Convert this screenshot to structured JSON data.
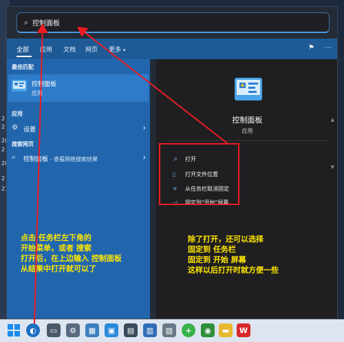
{
  "search": {
    "icon": "search-icon",
    "value": "控制面板"
  },
  "tabs": [
    {
      "label": "全部",
      "active": true
    },
    {
      "label": "应用"
    },
    {
      "label": "文档"
    },
    {
      "label": "网页"
    },
    {
      "label": "更多"
    }
  ],
  "tab_caret": "▾",
  "left": {
    "best_match_label": "最佳匹配",
    "best_match": {
      "title": "控制面板",
      "subtitle": "应用"
    },
    "apps_label": "应用",
    "settings_item": "设置",
    "web_label": "搜索网页",
    "web_item": {
      "title": "控制面板",
      "suffix": " - 查看网络搜索结果"
    }
  },
  "right": {
    "title": "控制面板",
    "subtitle": "应用",
    "actions": [
      {
        "icon": "open-icon",
        "label": "打开"
      },
      {
        "icon": "folder-location-icon",
        "label": "打开文件位置"
      },
      {
        "icon": "unpin-icon",
        "label": "从任务栏取消固定"
      },
      {
        "icon": "pin-icon",
        "label": "固定到\"开始\"屏幕"
      }
    ]
  },
  "annotations": {
    "left_lines": [
      "点击 任务栏左下角的",
      "开始菜单，或者 搜索",
      "打开后，在上边输入 控制面板",
      "从结果中打开就可以了"
    ],
    "right_lines": [
      "除了打开，还可以选择",
      "固定到 任务栏",
      "固定到 开始 屏幕",
      "这样以后打开时就方便一些"
    ]
  },
  "desktop_labels": [
    "2",
    "2",
    "20",
    "2",
    "28",
    "2",
    "21"
  ],
  "colors": {
    "accent": "#2166ad",
    "annotation": "#ffe600",
    "highlight": "#ee1c24"
  }
}
